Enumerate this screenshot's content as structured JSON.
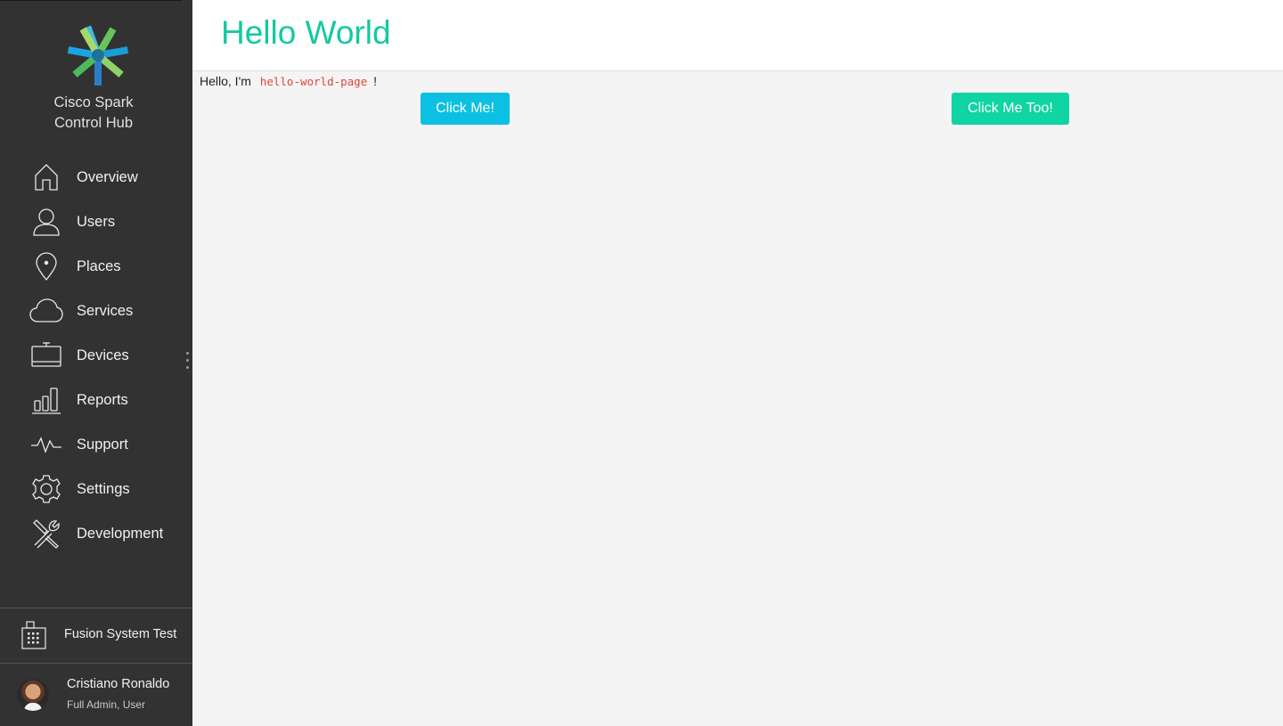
{
  "brand": {
    "name_line1": "Cisco Spark",
    "name_line2": "Control Hub"
  },
  "nav": [
    {
      "label": "Overview",
      "icon": "home-icon"
    },
    {
      "label": "Users",
      "icon": "user-icon"
    },
    {
      "label": "Places",
      "icon": "location-pin-icon"
    },
    {
      "label": "Services",
      "icon": "cloud-icon"
    },
    {
      "label": "Devices",
      "icon": "device-icon"
    },
    {
      "label": "Reports",
      "icon": "bar-chart-icon"
    },
    {
      "label": "Support",
      "icon": "pulse-icon"
    },
    {
      "label": "Settings",
      "icon": "gear-icon"
    },
    {
      "label": "Development",
      "icon": "tools-icon"
    }
  ],
  "org": {
    "name": "Fusion System Test"
  },
  "user": {
    "name": "Cristiano Ronaldo",
    "role": "Full Admin, User"
  },
  "header": {
    "title": "Hello World"
  },
  "content": {
    "greeting_prefix": "Hello, I'm",
    "component_name": "hello-world-page",
    "greeting_suffix": "!",
    "button_primary": "Click Me!",
    "button_secondary": "Click Me Too!"
  },
  "colors": {
    "sidebar_bg": "#323232",
    "accent_title": "#14c9a0",
    "button_primary": "#0bc0e3",
    "button_secondary": "#0fd4a3",
    "code_text": "#e0443a"
  }
}
